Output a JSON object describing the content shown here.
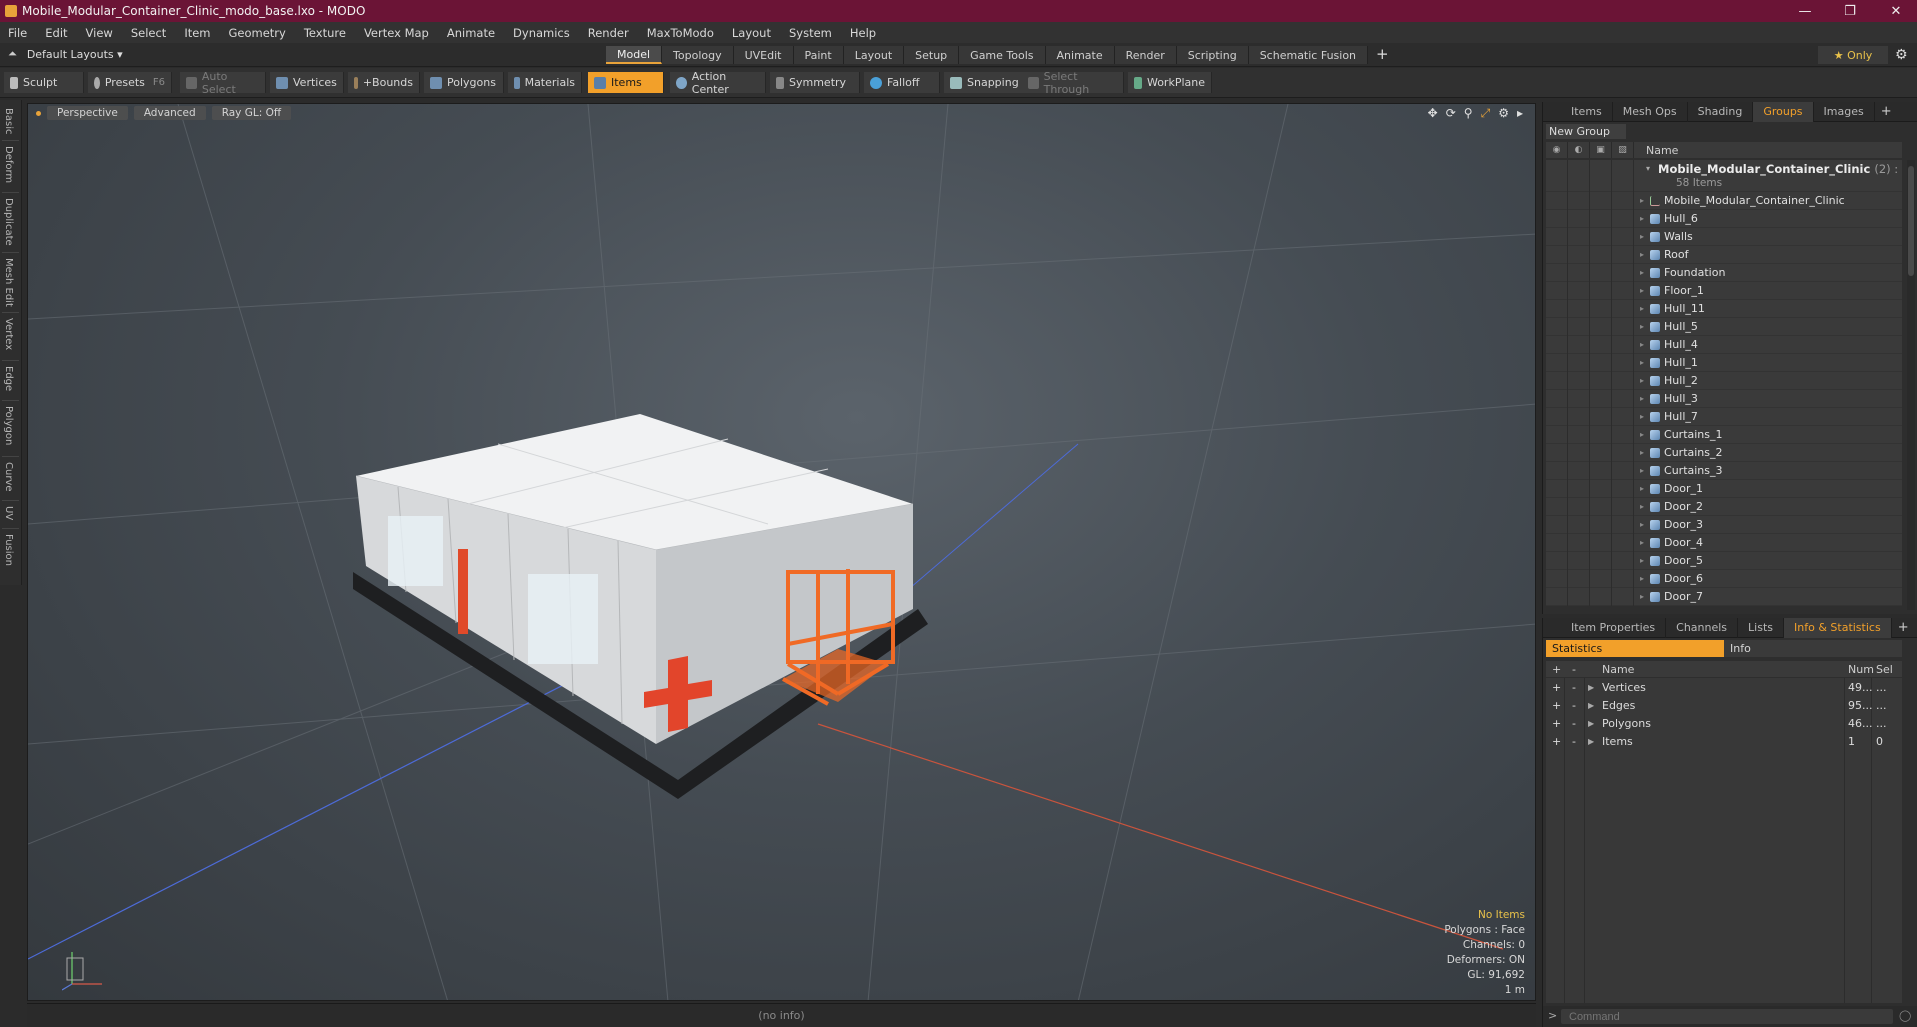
{
  "window": {
    "title": "Mobile_Modular_Container_Clinic_modo_base.lxo - MODO"
  },
  "menu": [
    "File",
    "Edit",
    "View",
    "Select",
    "Item",
    "Geometry",
    "Texture",
    "Vertex Map",
    "Animate",
    "Dynamics",
    "Render",
    "MaxToModo",
    "Layout",
    "System",
    "Help"
  ],
  "layouts": {
    "default_label": "Default Layouts",
    "tabs": [
      "Model",
      "Topology",
      "UVEdit",
      "Paint",
      "Layout",
      "Setup",
      "Game Tools",
      "Animate",
      "Render",
      "Scripting",
      "Schematic Fusion"
    ],
    "active_tab": "Model",
    "only_label": "Only"
  },
  "toolbar": {
    "sculpt": "Sculpt",
    "presets": "Presets",
    "presets_key": "F6",
    "auto_select": "Auto Select",
    "vertices": "Vertices",
    "bounds": "+Bounds",
    "polygons": "Polygons",
    "materials": "Materials",
    "items": "Items",
    "action_center": "Action Center",
    "symmetry": "Symmetry",
    "falloff": "Falloff",
    "snapping": "Snapping",
    "select_through": "Select Through",
    "workplane": "WorkPlane"
  },
  "left_tabs": [
    "Basic",
    "Deform",
    "Duplicate",
    "Mesh Edit",
    "Vertex",
    "Edge",
    "Polygon",
    "Curve",
    "UV",
    "Fusion"
  ],
  "viewport": {
    "view_mode": "Perspective",
    "shading": "Advanced",
    "raygl": "Ray GL: Off",
    "stats": {
      "no_items": "No Items",
      "polygons": "Polygons : Face",
      "channels": "Channels: 0",
      "deformers": "Deformers: ON",
      "gl": "GL: 91,692",
      "scale": "1 m"
    }
  },
  "status": {
    "text": "(no info)"
  },
  "groups_panel": {
    "tabs": [
      "Items",
      "Mesh Ops",
      "Shading",
      "Groups",
      "Images"
    ],
    "active_tab": "Groups",
    "new_group": "New Group",
    "name_header": "Name",
    "root": {
      "label": "Mobile_Modular_Container_Clinic",
      "count": "(2) : ...",
      "sub": "58 Items"
    },
    "items": [
      "Mobile_Modular_Container_Clinic",
      "Hull_6",
      "Walls",
      "Roof",
      "Foundation",
      "Floor_1",
      "Hull_11",
      "Hull_5",
      "Hull_4",
      "Hull_1",
      "Hull_2",
      "Hull_3",
      "Hull_7",
      "Curtains_1",
      "Curtains_2",
      "Curtains_3",
      "Door_1",
      "Door_2",
      "Door_3",
      "Door_4",
      "Door_5",
      "Door_6",
      "Door_7"
    ]
  },
  "info_panel": {
    "tabs": [
      "Item Properties",
      "Channels",
      "Lists",
      "Info & Statistics"
    ],
    "active_tab": "Info & Statistics",
    "subtabs": [
      "Statistics",
      "Info"
    ],
    "headers": {
      "plus": "+",
      "minus": "-",
      "name": "Name",
      "num": "Num",
      "sel": "Sel"
    },
    "rows": [
      {
        "name": "Vertices",
        "num": "49...",
        "sel": "..."
      },
      {
        "name": "Edges",
        "num": "95...",
        "sel": "..."
      },
      {
        "name": "Polygons",
        "num": "46...",
        "sel": "..."
      },
      {
        "name": "Items",
        "num": "1",
        "sel": "0"
      }
    ],
    "command_placeholder": "Command"
  },
  "colors": {
    "accent": "#f2a02a",
    "titlebar": "#6b1436",
    "cross": "#e2452b",
    "stairs": "#f06a25"
  }
}
